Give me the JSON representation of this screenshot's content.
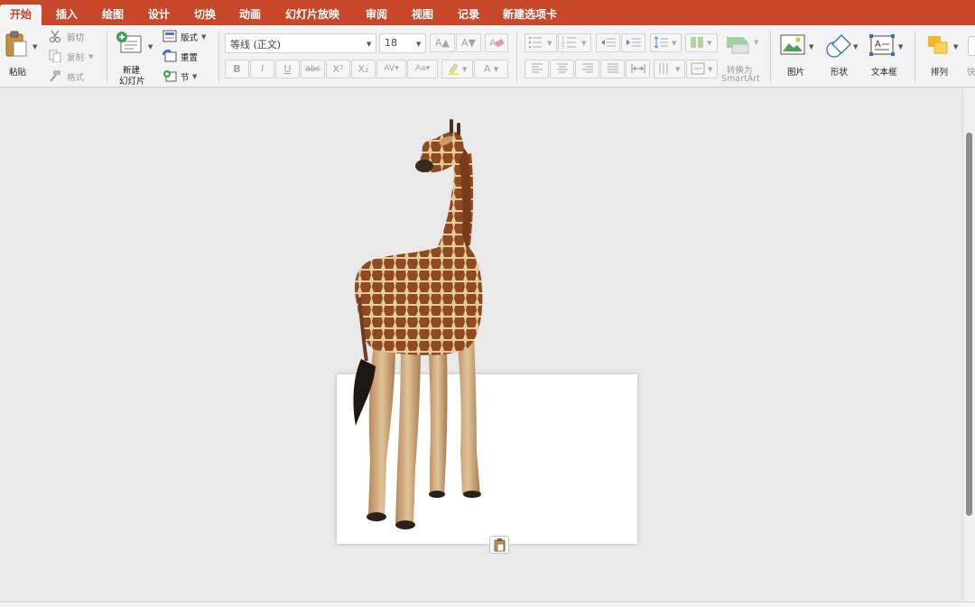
{
  "tabs": [
    {
      "label": "开始",
      "active": true
    },
    {
      "label": "插入"
    },
    {
      "label": "绘图"
    },
    {
      "label": "设计"
    },
    {
      "label": "切换"
    },
    {
      "label": "动画"
    },
    {
      "label": "幻灯片放映"
    },
    {
      "label": "审阅"
    },
    {
      "label": "视图"
    },
    {
      "label": "记录"
    },
    {
      "label": "新建选项卡"
    }
  ],
  "clipboard": {
    "paste": "粘贴",
    "cut": "剪切",
    "copy": "复制",
    "format": "格式"
  },
  "slides": {
    "new_slide": "新建\n幻灯片",
    "new_slide_line1": "新建",
    "new_slide_line2": "幻灯片",
    "layout": "版式",
    "reset": "重置",
    "section": "节"
  },
  "font": {
    "family": "等线 (正文)",
    "size": "18",
    "bold": "B",
    "italic": "I",
    "underline": "U",
    "strike": "abc",
    "superscript": "X²",
    "subscript": "X₂"
  },
  "paragraph": {
    "smartart_line1": "转换为",
    "smartart_line2": "SmartArt"
  },
  "insert": {
    "picture": "图片",
    "shape": "形状",
    "textbox": "文本框"
  },
  "arrange": {
    "label": "排列",
    "quick": "快"
  },
  "colors": {
    "brand": "#c6472a",
    "ribbon": "#f3f3f3",
    "canvas": "#e9e9e9"
  }
}
